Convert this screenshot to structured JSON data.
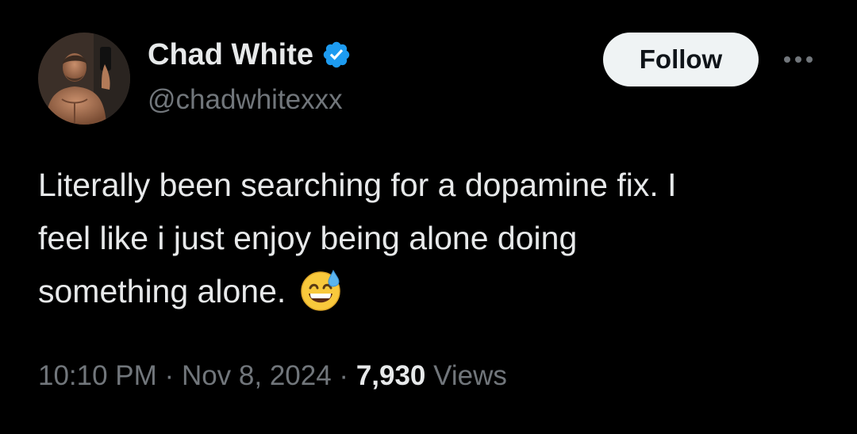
{
  "author": {
    "display_name": "Chad White",
    "handle": "@chadwhitexxx",
    "verified": true,
    "verified_color": "#1d9bf0"
  },
  "actions": {
    "follow_label": "Follow",
    "more_icon": "more-horizontal-icon"
  },
  "tweet": {
    "text_line_1": "Literally been searching for a dopamine fix. I",
    "text_line_2": "feel like i just enjoy being alone doing",
    "text_line_3": "something alone.",
    "emoji": "grinning-face-with-sweat"
  },
  "meta": {
    "time": "10:10 PM",
    "separator": "·",
    "date": "Nov 8, 2024",
    "views_count": "7,930",
    "views_label": "Views"
  },
  "colors": {
    "background": "#000000",
    "primary_text": "#e7e9ea",
    "secondary_text": "#71767b",
    "follow_bg": "#eff3f4",
    "follow_text": "#0f1419"
  }
}
